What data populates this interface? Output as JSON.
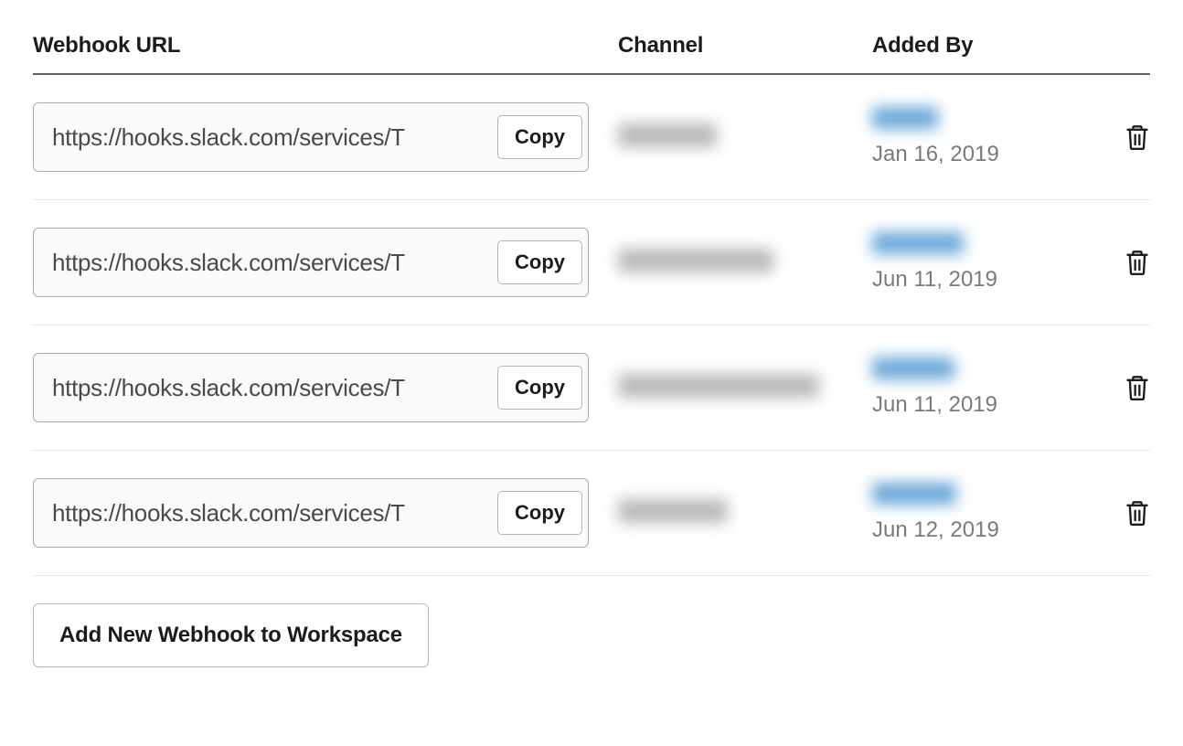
{
  "headers": {
    "webhook_url": "Webhook URL",
    "channel": "Channel",
    "added_by": "Added By"
  },
  "buttons": {
    "copy": "Copy",
    "add_new": "Add New Webhook to Workspace"
  },
  "webhooks": [
    {
      "url": "https://hooks.slack.com/services/T",
      "channel_blur_w": 108,
      "user_blur_w": 72,
      "date": "Jan 16, 2019"
    },
    {
      "url": "https://hooks.slack.com/services/T",
      "channel_blur_w": 170,
      "user_blur_w": 100,
      "date": "Jun 11, 2019"
    },
    {
      "url": "https://hooks.slack.com/services/T",
      "channel_blur_w": 220,
      "user_blur_w": 90,
      "date": "Jun 11, 2019"
    },
    {
      "url": "https://hooks.slack.com/services/T",
      "channel_blur_w": 120,
      "user_blur_w": 92,
      "date": "Jun 12, 2019"
    }
  ]
}
